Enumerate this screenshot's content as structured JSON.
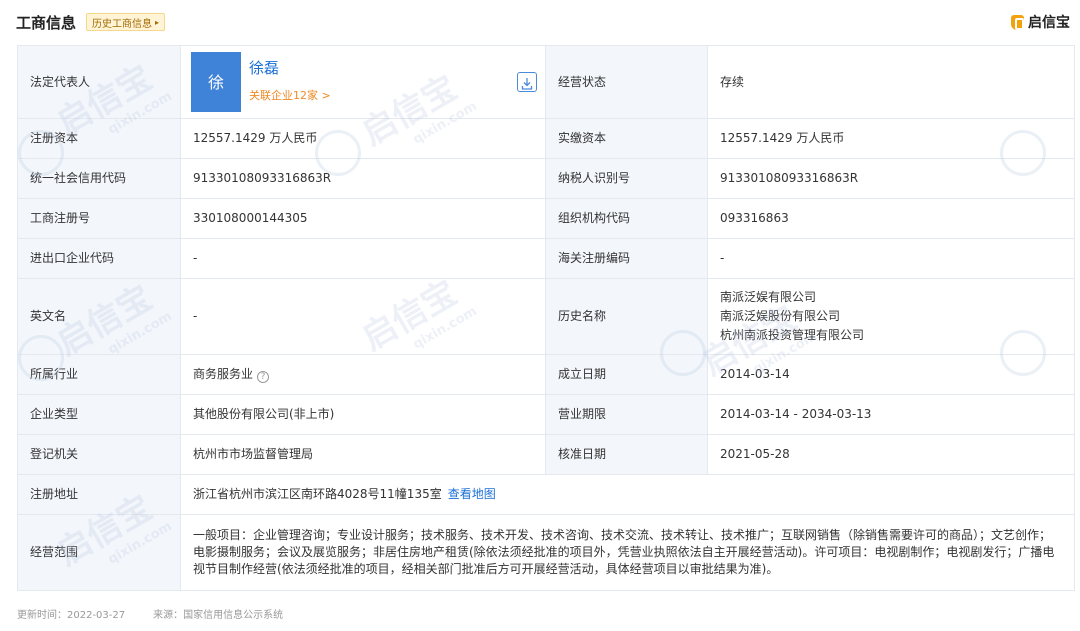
{
  "header": {
    "title": "工商信息",
    "history_tag": "历史工商信息",
    "history_tag_arrow": "▸",
    "brand": "启信宝"
  },
  "legal_rep": {
    "label": "法定代表人",
    "avatar_char": "徐",
    "name": "徐磊",
    "related": "关联企业12家 >"
  },
  "rows": {
    "status": {
      "label": "经营状态",
      "value": "存续"
    },
    "reg_capital": {
      "label": "注册资本",
      "value": "12557.1429 万人民币"
    },
    "paid_capital": {
      "label": "实缴资本",
      "value": "12557.1429 万人民币"
    },
    "credit_code": {
      "label": "统一社会信用代码",
      "value": "91330108093316863R"
    },
    "taxpayer_id": {
      "label": "纳税人识别号",
      "value": "91330108093316863R"
    },
    "reg_number": {
      "label": "工商注册号",
      "value": "330108000144305"
    },
    "org_code": {
      "label": "组织机构代码",
      "value": "093316863"
    },
    "import_export_code": {
      "label": "进出口企业代码",
      "value": "-"
    },
    "customs_code": {
      "label": "海关注册编码",
      "value": "-"
    },
    "english_name": {
      "label": "英文名",
      "value": "-"
    },
    "history_names": {
      "label": "历史名称",
      "values": [
        "南派泛娱有限公司",
        "南派泛娱股份有限公司",
        "杭州南派投资管理有限公司"
      ]
    },
    "industry": {
      "label": "所属行业",
      "value": "商务服务业",
      "help_icon": "?"
    },
    "founded": {
      "label": "成立日期",
      "value": "2014-03-14"
    },
    "company_type": {
      "label": "企业类型",
      "value": "其他股份有限公司(非上市)"
    },
    "business_term": {
      "label": "营业期限",
      "value": "2014-03-14 - 2034-03-13"
    },
    "reg_authority": {
      "label": "登记机关",
      "value": "杭州市市场监督管理局"
    },
    "approval_date": {
      "label": "核准日期",
      "value": "2021-05-28"
    },
    "address": {
      "label": "注册地址",
      "value": "浙江省杭州市滨江区南环路4028号11幢135室",
      "map_link": "查看地图"
    },
    "scope": {
      "label": "经营范围",
      "value": "一般项目：企业管理咨询；专业设计服务；技术服务、技术开发、技术咨询、技术交流、技术转让、技术推广；互联网销售（除销售需要许可的商品）；文艺创作；电影摄制服务；会议及展览服务；非居住房地产租赁(除依法须经批准的项目外，凭营业执照依法自主开展经营活动)。许可项目：电视剧制作；电视剧发行；广播电视节目制作经营(依法须经批准的项目，经相关部门批准后方可开展经营活动，具体经营项目以审批结果为准)。"
    }
  },
  "footer": {
    "updated": "更新时间：2022-03-27",
    "source": "来源：国家信用信息公示系统"
  },
  "watermark": {
    "text": "启信宝",
    "sub": "qixin.com"
  },
  "colors": {
    "label_bg": "#f3f6fb",
    "border": "#e4e8ef",
    "link_blue": "#1a6fd6",
    "orange": "#f08a24",
    "avatar_bg": "#3f83d8",
    "brand_orange": "#f2a20c"
  },
  "icons": {
    "export": "download-export-icon",
    "help": "question-circle-icon",
    "brand": "qixinbao-logo-icon"
  }
}
